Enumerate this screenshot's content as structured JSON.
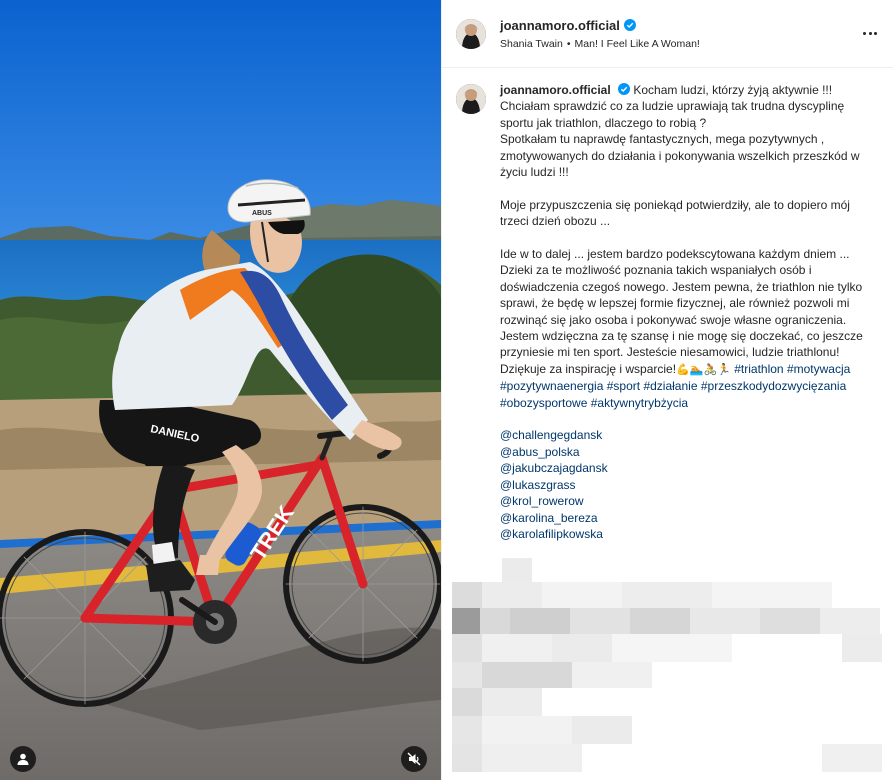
{
  "post": {
    "username": "joannamoro.official",
    "song_artist": "Shania Twain",
    "song_separator": "•",
    "song_title": "Man! I Feel Like A Woman!"
  },
  "caption": {
    "username": "joannamoro.official",
    "first_line": " Kocham ludzi, którzy żyją aktywnie !!!",
    "lines": [
      "Chciałam sprawdzić co za ludzie uprawiają tak trudna dyscyplinę sportu jak triathlon, dlaczego to robią ?",
      "Spotkałam tu naprawdę fantastycznych, mega pozytywnych , zmotywowanych do działania i pokonywania wszelkich przeszkód w życiu ludzi !!!"
    ],
    "para2": "Moje przypuszczenia się poniekąd potwierdziły, ale to dopiero mój trzeci dzień obozu ...",
    "para3": [
      "Ide w to dalej ... jestem bardzo podekscytowana każdym dniem ... Dzieki za te możliwość poznania takich wspaniałych osób i doświadczenia czegoś nowego. Jestem pewna, że triathlon nie tylko sprawi, że będę w lepszej formie fizycznej, ale również pozwoli mi rozwinąć się jako osoba i pokonywać swoje własne ograniczenia.",
      "Jestem wdzięczna za tę szansę i nie mogę się doczekać, co jeszcze przyniesie mi ten sport. Jesteście niesamowici, ludzie triathlonu!"
    ],
    "thanks": "Dziękuje za inspirację i wsparcie!",
    "emojis": "💪🏊🚴🏃",
    "hashtags": [
      "#triathlon",
      "#motywacja",
      "#pozytywnaenergia",
      "#sport",
      "#działanie",
      "#przeszkodydozwycięzania",
      "#obozysportowe",
      "#aktywnytrybżycia"
    ],
    "mentions": [
      "@challengegdansk",
      "@abus_polska",
      "@jakubczajagdansk",
      "@lukaszgrass",
      "@krol_rowerow",
      "@karolina_bereza",
      "@karolafilipkowska"
    ]
  },
  "media": {
    "helmet_brand": "ABUS",
    "shorts_brand": "DANIELO",
    "bike_brand": "TREK",
    "icons": [
      "user-tag-icon",
      "mute-icon"
    ]
  },
  "colors": {
    "link": "#00376b",
    "verified": "#0095f6",
    "text": "#262626"
  }
}
